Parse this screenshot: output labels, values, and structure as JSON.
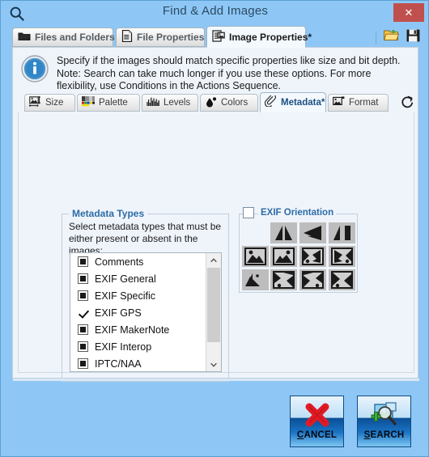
{
  "window": {
    "title": "Find & Add Images",
    "search_icon": "magnifier-icon",
    "close_label": "✕"
  },
  "main_tabs": [
    {
      "label": "Files and Folders",
      "icon": "folder-icon",
      "active": false
    },
    {
      "label": "File Properties",
      "icon": "document-icon",
      "active": false
    },
    {
      "label": "Image Properties*",
      "icon": "image-document-icon",
      "active": true
    }
  ],
  "toolbar_icons": [
    {
      "name": "open-folder-icon"
    },
    {
      "name": "save-disk-icon"
    }
  ],
  "info": {
    "icon": "info-circle-icon",
    "text": "Specify if the images should match specific properties like size and bit depth. Note: Search can take much longer if you use these options. For more flexibility, use Conditions in the Actions Sequence."
  },
  "sub_tabs": [
    {
      "label": "Size",
      "icon": "size-icon",
      "active": false
    },
    {
      "label": "Palette",
      "icon": "palette-icon",
      "active": false
    },
    {
      "label": "Levels",
      "icon": "levels-histogram-icon",
      "active": false
    },
    {
      "label": "Colors",
      "icon": "colors-droplet-icon",
      "active": false
    },
    {
      "label": "Metadata*",
      "icon": "paperclip-icon",
      "active": true
    },
    {
      "label": "Format",
      "icon": "format-image-icon",
      "active": false
    }
  ],
  "refresh_icon": "refresh-icon",
  "metadata_group": {
    "legend": "Metadata Types",
    "description": "Select metadata types that must be either present or absent in the images:",
    "items": [
      {
        "label": "Comments",
        "state": "partial"
      },
      {
        "label": "EXIF General",
        "state": "partial"
      },
      {
        "label": "EXIF Specific",
        "state": "partial"
      },
      {
        "label": "EXIF GPS",
        "state": "checked"
      },
      {
        "label": "EXIF MakerNote",
        "state": "partial"
      },
      {
        "label": "EXIF Interop",
        "state": "partial"
      },
      {
        "label": "IPTC/NAA",
        "state": "partial"
      }
    ],
    "scroll_up_icon": "chevron-up-icon",
    "scroll_down_icon": "chevron-down-icon"
  },
  "orientation_group": {
    "legend": "EXIF Orientation",
    "checkbox_state": "unchecked",
    "cells": [
      {
        "name": "orientation-cell-flip-h",
        "row": 0,
        "col": 1
      },
      {
        "name": "orientation-cell-rotate-180",
        "row": 0,
        "col": 2
      },
      {
        "name": "orientation-cell-flip-v",
        "row": 0,
        "col": 3
      },
      {
        "name": "orientation-cell-normal",
        "row": 1,
        "col": 0
      },
      {
        "name": "orientation-cell-mirror-h",
        "row": 1,
        "col": 1
      },
      {
        "name": "orientation-cell-rotate-90",
        "row": 1,
        "col": 2
      },
      {
        "name": "orientation-cell-rotate-270",
        "row": 1,
        "col": 3
      },
      {
        "name": "orientation-cell-transpose",
        "row": 2,
        "col": 0
      },
      {
        "name": "orientation-cell-transverse",
        "row": 2,
        "col": 1
      },
      {
        "name": "orientation-cell-rot90-mirror",
        "row": 2,
        "col": 2
      },
      {
        "name": "orientation-cell-rot270-mirror",
        "row": 2,
        "col": 3
      }
    ]
  },
  "buttons": {
    "cancel": {
      "prefix": "C",
      "rest": "ANCEL",
      "icon": "red-x-icon"
    },
    "search": {
      "prefix": "S",
      "rest": "EARCH",
      "icon": "magnifier-add-icon"
    }
  },
  "colors": {
    "window_bg": "#8ec7f5",
    "panel_bg": "#eff4fb",
    "accent_blue": "#2d6ca6",
    "close_red": "#c0504d",
    "cancel_x": "#e01b24"
  }
}
